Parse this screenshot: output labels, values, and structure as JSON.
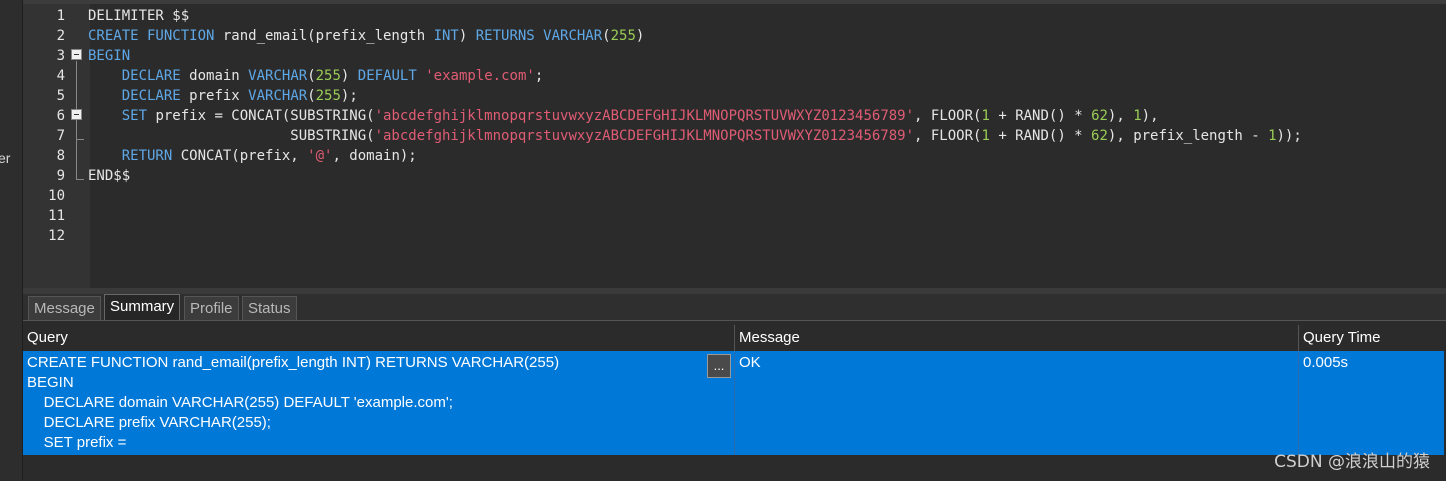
{
  "left_strip_text": "er",
  "editor": {
    "lines": [
      {
        "n": "1",
        "segs": [
          {
            "t": "DELIMITER $$",
            "c": "plain"
          }
        ]
      },
      {
        "n": "2",
        "segs": [
          {
            "t": "CREATE FUNCTION ",
            "c": "kw"
          },
          {
            "t": "rand_email(prefix_length ",
            "c": "plain"
          },
          {
            "t": "INT",
            "c": "kw"
          },
          {
            "t": ") ",
            "c": "plain"
          },
          {
            "t": "RETURNS VARCHAR",
            "c": "kw"
          },
          {
            "t": "(",
            "c": "plain"
          },
          {
            "t": "255",
            "c": "num"
          },
          {
            "t": ")",
            "c": "plain"
          }
        ]
      },
      {
        "n": "3",
        "segs": [
          {
            "t": "BEGIN",
            "c": "kw"
          }
        ]
      },
      {
        "n": "4",
        "segs": [
          {
            "t": "    ",
            "c": "plain"
          },
          {
            "t": "DECLARE",
            "c": "kw"
          },
          {
            "t": " domain ",
            "c": "plain"
          },
          {
            "t": "VARCHAR",
            "c": "kw"
          },
          {
            "t": "(",
            "c": "plain"
          },
          {
            "t": "255",
            "c": "num"
          },
          {
            "t": ") ",
            "c": "plain"
          },
          {
            "t": "DEFAULT",
            "c": "kw"
          },
          {
            "t": " ",
            "c": "plain"
          },
          {
            "t": "'example.com'",
            "c": "str"
          },
          {
            "t": ";",
            "c": "plain"
          }
        ]
      },
      {
        "n": "5",
        "segs": [
          {
            "t": "    ",
            "c": "plain"
          },
          {
            "t": "DECLARE",
            "c": "kw"
          },
          {
            "t": " prefix ",
            "c": "plain"
          },
          {
            "t": "VARCHAR",
            "c": "kw"
          },
          {
            "t": "(",
            "c": "plain"
          },
          {
            "t": "255",
            "c": "num"
          },
          {
            "t": ");",
            "c": "plain"
          }
        ]
      },
      {
        "n": "6",
        "segs": [
          {
            "t": "    ",
            "c": "plain"
          },
          {
            "t": "SET",
            "c": "kw"
          },
          {
            "t": " prefix = CONCAT(SUBSTRING(",
            "c": "plain"
          },
          {
            "t": "'abcdefghijklmnopqrstuvwxyzABCDEFGHIJKLMNOPQRSTUVWXYZ0123456789'",
            "c": "str"
          },
          {
            "t": ", FLOOR(",
            "c": "plain"
          },
          {
            "t": "1",
            "c": "num"
          },
          {
            "t": " + RAND() * ",
            "c": "plain"
          },
          {
            "t": "62",
            "c": "num"
          },
          {
            "t": "), ",
            "c": "plain"
          },
          {
            "t": "1",
            "c": "num"
          },
          {
            "t": "),",
            "c": "plain"
          }
        ]
      },
      {
        "n": "7",
        "segs": [
          {
            "t": "                        SUBSTRING(",
            "c": "plain"
          },
          {
            "t": "'abcdefghijklmnopqrstuvwxyzABCDEFGHIJKLMNOPQRSTUVWXYZ0123456789'",
            "c": "str"
          },
          {
            "t": ", FLOOR(",
            "c": "plain"
          },
          {
            "t": "1",
            "c": "num"
          },
          {
            "t": " + RAND() * ",
            "c": "plain"
          },
          {
            "t": "62",
            "c": "num"
          },
          {
            "t": "), prefix_length - ",
            "c": "plain"
          },
          {
            "t": "1",
            "c": "num"
          },
          {
            "t": "));",
            "c": "plain"
          }
        ]
      },
      {
        "n": "8",
        "segs": [
          {
            "t": "    ",
            "c": "plain"
          },
          {
            "t": "RETURN",
            "c": "kw"
          },
          {
            "t": " CONCAT(prefix, ",
            "c": "plain"
          },
          {
            "t": "'@'",
            "c": "str"
          },
          {
            "t": ", domain);",
            "c": "plain"
          }
        ]
      },
      {
        "n": "9",
        "segs": [
          {
            "t": "END$$",
            "c": "plain"
          }
        ]
      },
      {
        "n": "10",
        "segs": []
      },
      {
        "n": "11",
        "segs": []
      },
      {
        "n": "12",
        "segs": []
      }
    ],
    "colors": {
      "kw": "#5fa8e8",
      "str": "#e05c74",
      "num": "#9acd57",
      "plain": "#e6e6e6"
    }
  },
  "tabs": [
    {
      "label": "Message",
      "active": false
    },
    {
      "label": "Summary",
      "active": true
    },
    {
      "label": "Profile",
      "active": false
    },
    {
      "label": "Status",
      "active": false
    }
  ],
  "grid": {
    "headers": {
      "query": "Query",
      "message": "Message",
      "time": "Query Time"
    },
    "row": {
      "query": "CREATE FUNCTION rand_email(prefix_length INT) RETURNS VARCHAR(255)\nBEGIN\n    DECLARE domain VARCHAR(255) DEFAULT 'example.com';\n    DECLARE prefix VARCHAR(255);\n    SET prefix =",
      "message": "OK",
      "time": "0.005s",
      "expand_label": "..."
    }
  },
  "watermark": "CSDN @浪浪山的猿"
}
